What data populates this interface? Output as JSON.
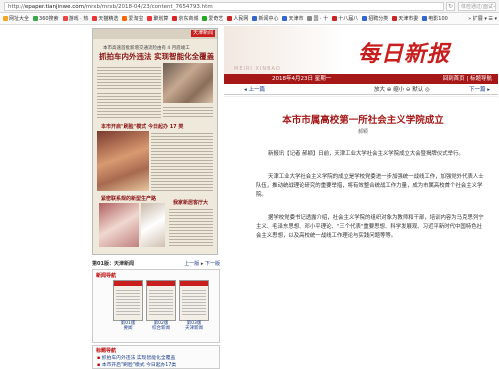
{
  "browser": {
    "url_prefix": "http://",
    "url_domain": "epaper.tianjinwe.com",
    "url_rest": "/mrxb/mrxb/2018-04/23/content_7654793.htm",
    "search_placeholder": "体检通过(面试+)",
    "bookmarks": [
      {
        "label": "网址大全",
        "color": "#f5a623"
      },
      {
        "label": "360搜索",
        "color": "#3aa84a"
      },
      {
        "label": "游戏 · 热",
        "color": "#e44"
      },
      {
        "label": "天猫精选",
        "color": "#e33"
      },
      {
        "label": "爱淘宝",
        "color": "#f60"
      },
      {
        "label": "聚划算",
        "color": "#e33"
      },
      {
        "label": "京东商城",
        "color": "#d22"
      },
      {
        "label": "爱奇艺",
        "color": "#2a2"
      },
      {
        "label": "人民网",
        "color": "#c22"
      },
      {
        "label": "新闻中心",
        "color": "#36c"
      },
      {
        "label": "天津市",
        "color": "#36c"
      },
      {
        "label": "国 · 十",
        "color": "#888"
      },
      {
        "label": "十八届八",
        "color": "#c22"
      },
      {
        "label": "招聘分类",
        "color": "#36c"
      },
      {
        "label": "天津市委",
        "color": "#c22"
      },
      {
        "label": "电影100",
        "color": "#36c"
      }
    ],
    "bookmarks_more": "» 扩展 ▾ ☰ ▾"
  },
  "paper": {
    "scan_label": "天津新闻",
    "scan_sub": "本市高速首批新增交通流险由有 4 月底竣工",
    "scan_headline": "抓拍车内外违法 实现智能化全覆盖",
    "scan_mid": "本市开启\"刷脸\"模式 今日起办 17 类",
    "scan_low1": "紧密联系规的新型生产路",
    "scan_low2": "我家新居客厅大",
    "page_label": "第01版：天津新闻",
    "prev_page": "上一版",
    "next_page": "下一版",
    "thumbs_title": "新闻导航",
    "thumbs": [
      {
        "label1": "第01版",
        "label2": "要闻"
      },
      {
        "label1": "第02版",
        "label2": "综合新闻"
      },
      {
        "label1": "第03版",
        "label2": "天津新闻"
      }
    ],
    "list_title": "标题导航",
    "list_items": [
      "抓拍车内外违法 实现智能化全覆盖",
      "本市开启\"刷脸\"模式 今日起办17类"
    ]
  },
  "content": {
    "logo": "每日新报",
    "slogan": "MEIRI XINBAO",
    "date": "2018年4月23日 星期一",
    "home_link": "回到首页 | 标题导航",
    "prev_article": "上一篇",
    "font_controls": "放大 ⊕ 缩小 ⊖ 默认 ◎",
    "next_article": "下一篇",
    "title": "本市市属高校第一所社会主义学院成立",
    "author": "郝颖",
    "paragraphs": [
      "新报讯【记者 郝颖】日前，天津工业大学社会主义学院成立大会暨揭牌仪式举行。",
      "天津工业大学社会主义学院的成立是学校党委进一步加强统一战线工作，加强党外代表人士队伍，推动统战理论研究的重要举措，将有效整合统战工作力量，成为市属高校首个社会主义学院。",
      "据学校党委书记透露介绍，社会主义学院的组织对象为教师和干部，培训内容为马克思列宁主义、毛泽东思想、邓小平理论、\"三个代表\"重要思想、科学发展观、习近平新时代中国特色社会主义思想，以及高校统一战线工作理论与实践问题等等。"
    ]
  }
}
